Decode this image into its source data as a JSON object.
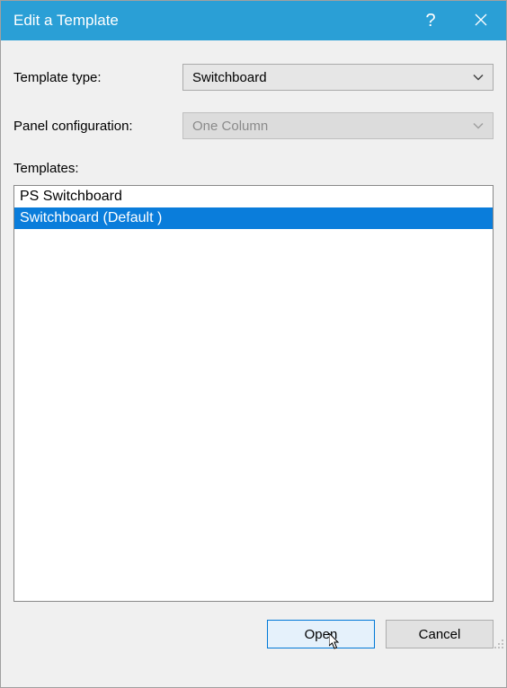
{
  "titlebar": {
    "title": "Edit a Template"
  },
  "form": {
    "template_type_label": "Template type:",
    "template_type_value": "Switchboard",
    "panel_config_label": "Panel configuration:",
    "panel_config_value": "One Column",
    "templates_label": "Templates:"
  },
  "templates": {
    "items": [
      {
        "label": "PS Switchboard",
        "selected": false
      },
      {
        "label": "Switchboard (Default )",
        "selected": true
      }
    ]
  },
  "buttons": {
    "open": "Open",
    "cancel": "Cancel"
  }
}
